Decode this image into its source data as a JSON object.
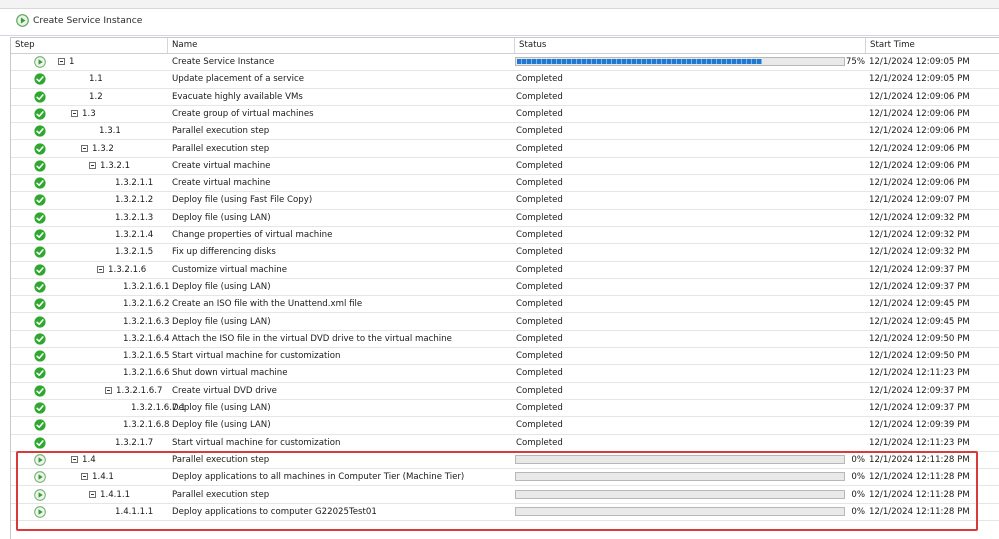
{
  "window": {
    "title": "Create Service Instance"
  },
  "columns": {
    "step": "Step",
    "name": "Name",
    "status": "Status",
    "start_time": "Start Time"
  },
  "colors": {
    "success": "#2ea82e",
    "running": "#6fb36f",
    "progress": "#1f78d1",
    "highlight": "#d93a3a"
  },
  "rows": [
    {
      "step": "1",
      "name": "Create Service Instance",
      "status": "",
      "progress": 75,
      "progress_label": "75%",
      "start": "12/1/2024 12:09:05 PM",
      "icon": "play-icon",
      "level": 0,
      "expander": true
    },
    {
      "step": "1.1",
      "name": "Update placement of a service",
      "status": "Completed",
      "start": "12/1/2024 12:09:05 PM",
      "icon": "check-icon",
      "level": 1,
      "expander": false
    },
    {
      "step": "1.2",
      "name": "Evacuate highly available VMs",
      "status": "Completed",
      "start": "12/1/2024 12:09:06 PM",
      "icon": "check-icon",
      "level": 1,
      "expander": false
    },
    {
      "step": "1.3",
      "name": "Create group of virtual machines",
      "status": "Completed",
      "start": "12/1/2024 12:09:06 PM",
      "icon": "check-icon",
      "level": 1,
      "expander": true
    },
    {
      "step": "1.3.1",
      "name": "Parallel execution step",
      "status": "Completed",
      "start": "12/1/2024 12:09:06 PM",
      "icon": "check-icon",
      "level": 2,
      "expander": false
    },
    {
      "step": "1.3.2",
      "name": "Parallel execution step",
      "status": "Completed",
      "start": "12/1/2024 12:09:06 PM",
      "icon": "check-icon",
      "level": 2,
      "expander": true
    },
    {
      "step": "1.3.2.1",
      "name": "Create virtual machine",
      "status": "Completed",
      "start": "12/1/2024 12:09:06 PM",
      "icon": "check-icon",
      "level": 3,
      "expander": true
    },
    {
      "step": "1.3.2.1.1",
      "name": "Create virtual machine",
      "status": "Completed",
      "start": "12/1/2024 12:09:06 PM",
      "icon": "check-icon",
      "level": 4,
      "expander": false
    },
    {
      "step": "1.3.2.1.2",
      "name": "Deploy file (using Fast File Copy)",
      "status": "Completed",
      "start": "12/1/2024 12:09:07 PM",
      "icon": "check-icon",
      "level": 4,
      "expander": false
    },
    {
      "step": "1.3.2.1.3",
      "name": "Deploy file (using LAN)",
      "status": "Completed",
      "start": "12/1/2024 12:09:32 PM",
      "icon": "check-icon",
      "level": 4,
      "expander": false
    },
    {
      "step": "1.3.2.1.4",
      "name": "Change properties of virtual machine",
      "status": "Completed",
      "start": "12/1/2024 12:09:32 PM",
      "icon": "check-icon",
      "level": 4,
      "expander": false
    },
    {
      "step": "1.3.2.1.5",
      "name": "Fix up differencing disks",
      "status": "Completed",
      "start": "12/1/2024 12:09:32 PM",
      "icon": "check-icon",
      "level": 4,
      "expander": false
    },
    {
      "step": "1.3.2.1.6",
      "name": "Customize virtual machine",
      "status": "Completed",
      "start": "12/1/2024 12:09:37 PM",
      "icon": "check-icon",
      "level": 4,
      "expander": true
    },
    {
      "step": "1.3.2.1.6.1",
      "name": "Deploy file (using LAN)",
      "status": "Completed",
      "start": "12/1/2024 12:09:37 PM",
      "icon": "check-icon",
      "level": 5,
      "expander": false
    },
    {
      "step": "1.3.2.1.6.2",
      "name": "Create an ISO file with the Unattend.xml file",
      "status": "Completed",
      "start": "12/1/2024 12:09:45 PM",
      "icon": "check-icon",
      "level": 5,
      "expander": false
    },
    {
      "step": "1.3.2.1.6.3",
      "name": "Deploy file (using LAN)",
      "status": "Completed",
      "start": "12/1/2024 12:09:45 PM",
      "icon": "check-icon",
      "level": 5,
      "expander": false
    },
    {
      "step": "1.3.2.1.6.4",
      "name": "Attach the ISO file in the virtual DVD drive to the virtual machine",
      "status": "Completed",
      "start": "12/1/2024 12:09:50 PM",
      "icon": "check-icon",
      "level": 5,
      "expander": false
    },
    {
      "step": "1.3.2.1.6.5",
      "name": "Start virtual machine for customization",
      "status": "Completed",
      "start": "12/1/2024 12:09:50 PM",
      "icon": "check-icon",
      "level": 5,
      "expander": false
    },
    {
      "step": "1.3.2.1.6.6",
      "name": "Shut down virtual machine",
      "status": "Completed",
      "start": "12/1/2024 12:11:23 PM",
      "icon": "check-icon",
      "level": 5,
      "expander": false
    },
    {
      "step": "1.3.2.1.6.7",
      "name": "Create virtual DVD drive",
      "status": "Completed",
      "start": "12/1/2024 12:09:37 PM",
      "icon": "check-icon",
      "level": 5,
      "expander": true
    },
    {
      "step": "1.3.2.1.6.7.1",
      "name": "Deploy file (using LAN)",
      "status": "Completed",
      "start": "12/1/2024 12:09:37 PM",
      "icon": "check-icon",
      "level": 6,
      "expander": false
    },
    {
      "step": "1.3.2.1.6.8",
      "name": "Deploy file (using LAN)",
      "status": "Completed",
      "start": "12/1/2024 12:09:39 PM",
      "icon": "check-icon",
      "level": 5,
      "expander": false
    },
    {
      "step": "1.3.2.1.7",
      "name": "Start virtual machine for customization",
      "status": "Completed",
      "start": "12/1/2024 12:11:23 PM",
      "icon": "check-icon",
      "level": 4,
      "expander": false
    },
    {
      "step": "1.4",
      "name": "Parallel execution step",
      "status": "",
      "progress": 0,
      "progress_label": "0%",
      "start": "12/1/2024 12:11:28 PM",
      "icon": "play-icon",
      "level": 1,
      "expander": true
    },
    {
      "step": "1.4.1",
      "name": "Deploy applications to all machines in Computer Tier (Machine Tier)",
      "status": "",
      "progress": 0,
      "progress_label": "0%",
      "start": "12/1/2024 12:11:28 PM",
      "icon": "play-icon",
      "level": 2,
      "expander": true
    },
    {
      "step": "1.4.1.1",
      "name": "Parallel execution step",
      "status": "",
      "progress": 0,
      "progress_label": "0%",
      "start": "12/1/2024 12:11:28 PM",
      "icon": "play-icon",
      "level": 3,
      "expander": true
    },
    {
      "step": "1.4.1.1.1",
      "name": "Deploy applications to computer G22025Test01",
      "status": "",
      "progress": 0,
      "progress_label": "0%",
      "start": "12/1/2024 12:11:28 PM",
      "icon": "play-icon",
      "level": 4,
      "expander": false
    }
  ]
}
